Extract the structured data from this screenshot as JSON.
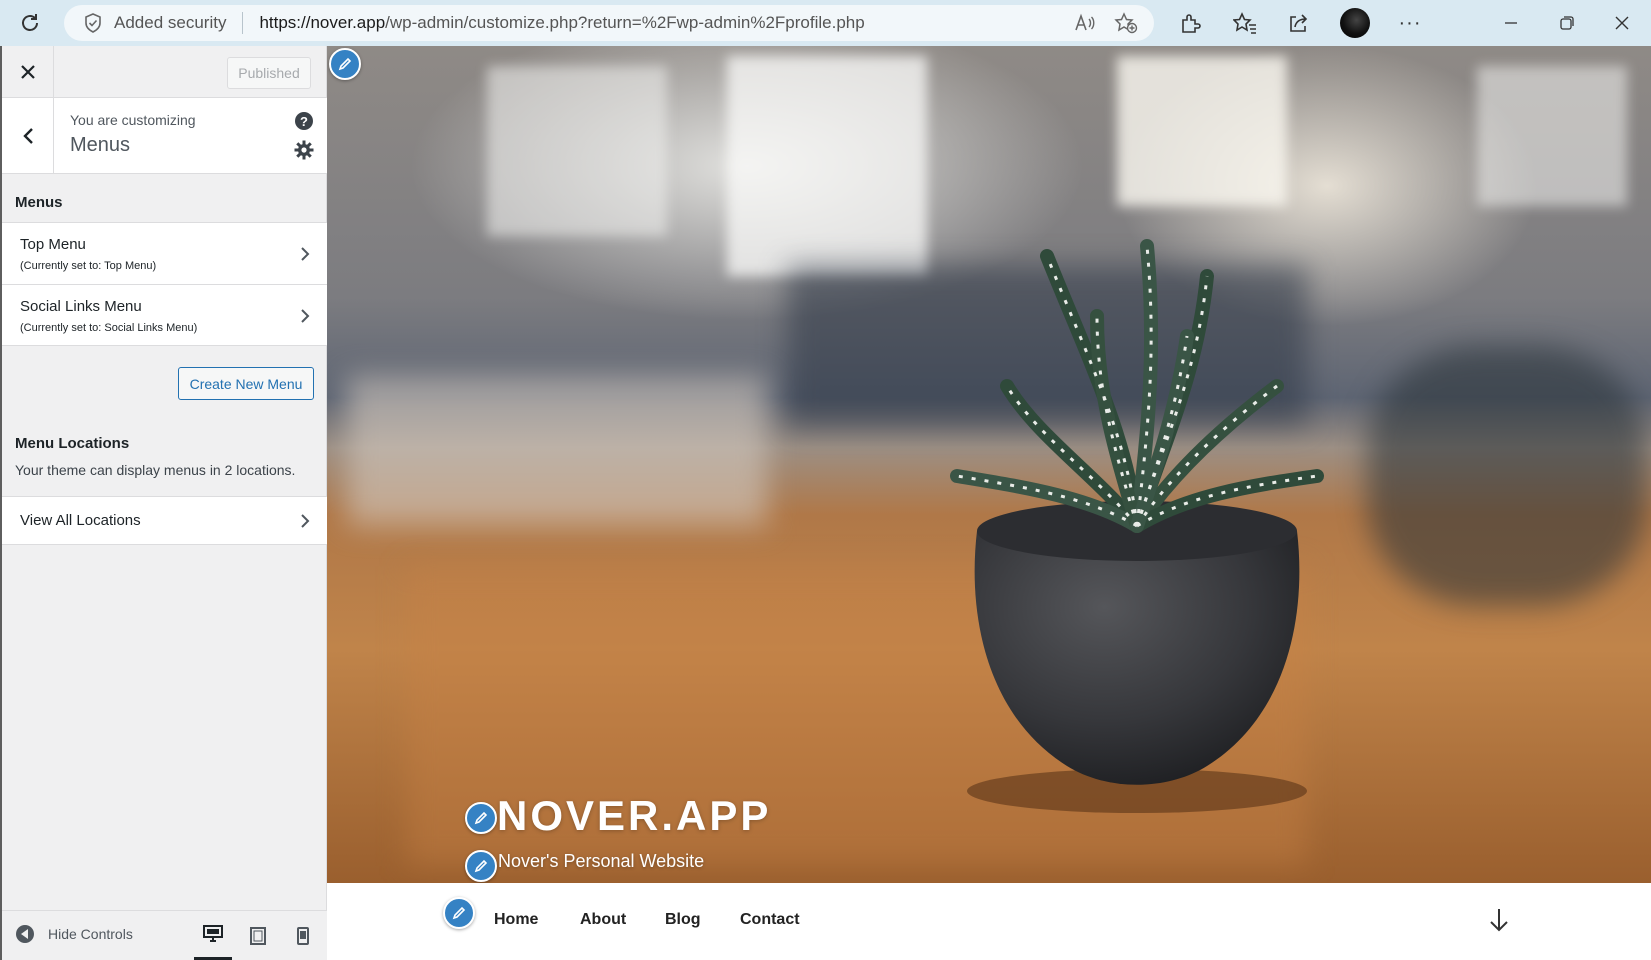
{
  "browser": {
    "security_label": "Added security",
    "url_host": "https://nover.app",
    "url_path": "/wp-admin/customize.php?return=%2Fwp-admin%2Fprofile.php"
  },
  "sidebar": {
    "publish_label": "Published",
    "customizing_label": "You are customizing",
    "section_title": "Menus",
    "menus_heading": "Menus",
    "menus": [
      {
        "name": "Top Menu",
        "status": "(Currently set to: Top Menu)"
      },
      {
        "name": "Social Links Menu",
        "status": "(Currently set to: Social Links Menu)"
      }
    ],
    "create_menu_label": "Create New Menu",
    "locations_heading": "Menu Locations",
    "locations_desc": "Your theme can display menus in 2 locations.",
    "view_all_label": "View All Locations",
    "hide_controls_label": "Hide Controls",
    "devices": [
      "desktop-icon",
      "tablet-icon",
      "mobile-icon"
    ]
  },
  "preview": {
    "site_title": "NOVER.APP",
    "tagline": "Nover's Personal Website",
    "nav": [
      "Home",
      "About",
      "Blog",
      "Contact"
    ]
  },
  "colors": {
    "accent": "#2271b1",
    "edit_shortcut": "#3582c4",
    "browser_bar": "#d9e9f2"
  }
}
